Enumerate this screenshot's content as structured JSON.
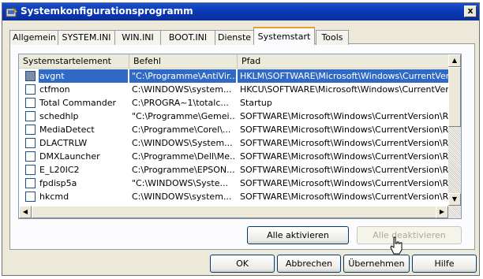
{
  "window": {
    "title": "Systemkonfigurationsprogramm",
    "close_label": "x"
  },
  "tabs": [
    {
      "label": "Allgemein",
      "active": false
    },
    {
      "label": "SYSTEM.INI",
      "active": false
    },
    {
      "label": "WIN.INI",
      "active": false
    },
    {
      "label": "BOOT.INI",
      "active": false
    },
    {
      "label": "Dienste",
      "active": false
    },
    {
      "label": "Systemstart",
      "active": true
    },
    {
      "label": "Tools",
      "active": false
    }
  ],
  "list": {
    "columns": [
      "Systemstartelement",
      "Befehl",
      "Pfad"
    ],
    "rows": [
      {
        "name": "avgnt",
        "command": "\"C:\\Programme\\AntiVir...",
        "path": "HKLM\\SOFTWARE\\Microsoft\\Windows\\CurrentVer...",
        "selected": true
      },
      {
        "name": "ctfmon",
        "command": "C:\\WINDOWS\\system...",
        "path": "HKCU\\SOFTWARE\\Microsoft\\Windows\\CurrentVer...",
        "selected": false
      },
      {
        "name": "Total Commander",
        "command": "C:\\PROGRA~1\\totalc...",
        "path": "Startup",
        "selected": false
      },
      {
        "name": "schedhlp",
        "command": "\"C:\\Programme\\Gemei...",
        "path": "SOFTWARE\\Microsoft\\Windows\\CurrentVersion\\Ru",
        "selected": false
      },
      {
        "name": "MediaDetect",
        "command": "C:\\Programme\\Corel\\...",
        "path": "SOFTWARE\\Microsoft\\Windows\\CurrentVersion\\Ru",
        "selected": false
      },
      {
        "name": "DLACTRLW",
        "command": "C:\\WINDOWS\\System...",
        "path": "SOFTWARE\\Microsoft\\Windows\\CurrentVersion\\Ru",
        "selected": false
      },
      {
        "name": "DMXLauncher",
        "command": "C:\\Programme\\Dell\\Me...",
        "path": "SOFTWARE\\Microsoft\\Windows\\CurrentVersion\\Ru",
        "selected": false
      },
      {
        "name": "E_L20IC2",
        "command": "C:\\Programme\\EPSON...",
        "path": "SOFTWARE\\Microsoft\\Windows\\CurrentVersion\\Ru",
        "selected": false
      },
      {
        "name": "fpdisp5a",
        "command": "\"C:\\WINDOWS\\Syste...",
        "path": "SOFTWARE\\Microsoft\\Windows\\CurrentVersion\\Ru",
        "selected": false
      },
      {
        "name": "hkcmd",
        "command": "C:\\WINDOWS\\system...",
        "path": "SOFTWARE\\Microsoft\\Windows\\CurrentVersion\\Ru",
        "selected": false
      }
    ]
  },
  "buttons": {
    "enable_all": "Alle aktivieren",
    "disable_all": "Alle deaktivieren",
    "ok": "OK",
    "cancel": "Abbrechen",
    "apply": "Übernehmen",
    "help": "Hilfe"
  },
  "colors": {
    "titlebar": "#0a3ab8",
    "selection": "#316ac5",
    "active_tab_accent": "#e6a02e"
  }
}
